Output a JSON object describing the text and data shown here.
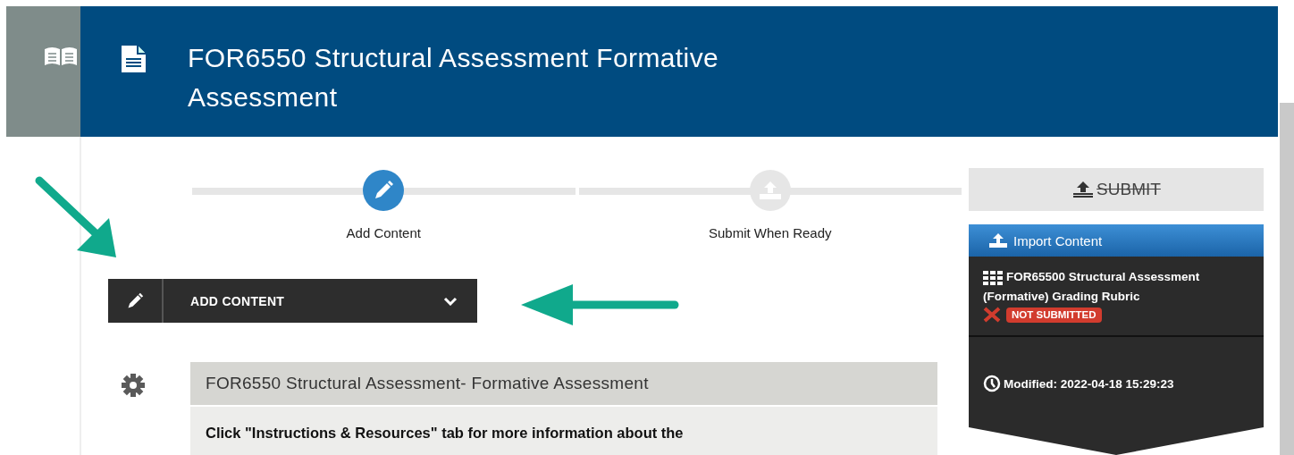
{
  "header": {
    "title": "FOR6550 Structural Assessment Formative Assessment"
  },
  "steps": [
    {
      "label": "Add Content",
      "selected": true
    },
    {
      "label": "Submit When Ready",
      "selected": false
    }
  ],
  "submit_button": {
    "label": "SUBMIT",
    "disabled": true
  },
  "add_content_button": {
    "label": "ADD CONTENT"
  },
  "content_panel": {
    "title": "FOR6550 Structural Assessment- Formative Assessment",
    "body": "Click \"Instructions & Resources\" tab for more information about the"
  },
  "side_panel": {
    "import_button": "Import Content",
    "items": [
      {
        "title": "FOR65500 Structural Assessment (Formative) Grading Rubric",
        "status": "NOT SUBMITTED",
        "submitted": false
      }
    ],
    "modified": "Modified: 2022-04-18 15:29:23"
  }
}
